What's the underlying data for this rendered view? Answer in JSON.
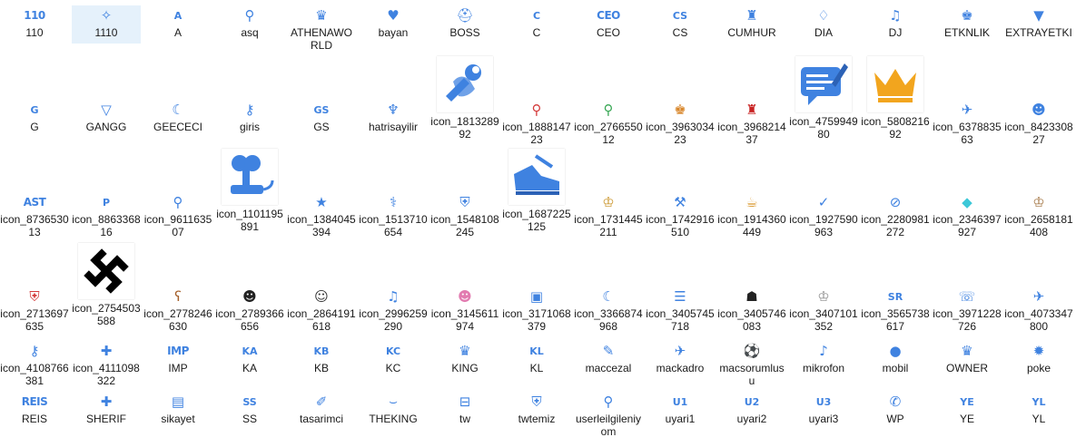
{
  "items": [
    {
      "label": "110",
      "icon": "110-text-icon",
      "text": "110"
    },
    {
      "label": "1110",
      "icon": "wings-icon",
      "glyph": "✧"
    },
    {
      "label": "A",
      "icon": "a-letter-icon",
      "text": "A"
    },
    {
      "label": "asq",
      "icon": "user-search-icon",
      "glyph": "⚲"
    },
    {
      "label": "ATHENAWORLD",
      "icon": "crown-icon",
      "glyph": "♛"
    },
    {
      "label": "bayan",
      "icon": "heart-icon",
      "glyph": "♥"
    },
    {
      "label": "BOSS",
      "icon": "helmet-icon",
      "glyph": "⛑"
    },
    {
      "label": "C",
      "icon": "c-letter-icon",
      "text": "C"
    },
    {
      "label": "CEO",
      "icon": "ceo-text-icon",
      "text": "CEO"
    },
    {
      "label": "CS",
      "icon": "cs-text-icon",
      "text": "CS"
    },
    {
      "label": "CUMHUR",
      "icon": "statue-icon",
      "glyph": "♜"
    },
    {
      "label": "DIA",
      "icon": "diamond-icon",
      "glyph": "♢"
    },
    {
      "label": "DJ",
      "icon": "music-note-icon",
      "glyph": "♫"
    },
    {
      "label": "ETKNLIK",
      "icon": "staff-user-icon",
      "glyph": "♚"
    },
    {
      "label": "EXTRAYETKI",
      "icon": "triangle-badge-icon",
      "glyph": "▼"
    },
    {
      "label": "G",
      "icon": "g-letter-icon",
      "text": "G"
    },
    {
      "label": "GANGG",
      "icon": "v-shield-icon",
      "glyph": "▽"
    },
    {
      "label": "GEECECI",
      "icon": "moon-icon",
      "glyph": "☾"
    },
    {
      "label": "giris",
      "icon": "key-icon",
      "glyph": "⚷"
    },
    {
      "label": "GS",
      "icon": "gs-text-icon",
      "text": "GS"
    },
    {
      "label": "hatrisayilir",
      "icon": "wings-emblem-icon",
      "glyph": "♆"
    },
    {
      "label": "icon_181328992",
      "icon": "wrench-hand-icon",
      "big": "wrench"
    },
    {
      "label": "icon_188814723",
      "icon": "user-red-badge-icon",
      "glyph": "⚲",
      "color": "#d43b3b"
    },
    {
      "label": "icon_276655012",
      "icon": "user-green-badge-icon",
      "glyph": "⚲",
      "color": "#3aa856"
    },
    {
      "label": "icon_396303423",
      "icon": "king-avatar-icon",
      "glyph": "♚",
      "color": "#d8862a"
    },
    {
      "label": "icon_396821437",
      "icon": "red-top-hat-icon",
      "glyph": "♜",
      "color": "#c82121"
    },
    {
      "label": "icon_475994980",
      "icon": "chat-edit-icon",
      "big": "chat"
    },
    {
      "label": "icon_580821692",
      "icon": "gold-crown-icon",
      "big": "crown"
    },
    {
      "label": "icon_637883563",
      "icon": "running-soldier-icon",
      "glyph": "✈"
    },
    {
      "label": "icon_842330827",
      "icon": "user-icon",
      "glyph": "☻"
    },
    {
      "label": "icon_873653013",
      "icon": "ast-text-icon",
      "text": "AST"
    },
    {
      "label": "icon_886336816",
      "icon": "p-badge-icon",
      "text": "P"
    },
    {
      "label": "icon_961163507",
      "icon": "user-search-icon",
      "glyph": "⚲"
    },
    {
      "label": "icon_1101195891",
      "icon": "joystick-icon",
      "big": "joystick"
    },
    {
      "label": "icon_1384045394",
      "icon": "star-icon",
      "glyph": "★"
    },
    {
      "label": "icon_1513710654",
      "icon": "syringe-icon",
      "glyph": "⚕"
    },
    {
      "label": "icon_1548108245",
      "icon": "shield-icon",
      "glyph": "⛨"
    },
    {
      "label": "icon_1687225125",
      "icon": "sneaker-icon",
      "big": "shoe"
    },
    {
      "label": "icon_1731445211",
      "icon": "trophy-icon",
      "glyph": "♔",
      "color": "#c89020"
    },
    {
      "label": "icon_1742916510",
      "icon": "gavel-icon",
      "glyph": "⚒"
    },
    {
      "label": "icon_1914360449",
      "icon": "beer-mug-icon",
      "glyph": "☕",
      "color": "#d8962a"
    },
    {
      "label": "icon_1927590963",
      "icon": "checkmark-icon",
      "glyph": "✓"
    },
    {
      "label": "icon_2280981272",
      "icon": "bandage-icon",
      "glyph": "⊘"
    },
    {
      "label": "icon_2346397927",
      "icon": "gem-icon",
      "glyph": "◆",
      "color": "#3dc8d8"
    },
    {
      "label": "icon_2658181408",
      "icon": "bronze-trophy-icon",
      "glyph": "♔",
      "color": "#a0703c"
    },
    {
      "label": "icon_2713697635",
      "icon": "red-shield-icon",
      "glyph": "⛨",
      "color": "#d43b3b"
    },
    {
      "label": "icon_2754503588",
      "icon": "swastika-icon",
      "big": "swastika"
    },
    {
      "label": "icon_2778246630",
      "icon": "teddy-bear-icon",
      "glyph": "ʕ",
      "color": "#a5602a"
    },
    {
      "label": "icon_2789366656",
      "icon": "cat-face-icon",
      "glyph": "☻",
      "color": "#222222"
    },
    {
      "label": "icon_2864191618",
      "icon": "face-icon",
      "glyph": "☺",
      "color": "#333333"
    },
    {
      "label": "icon_2996259290",
      "icon": "bell-icon",
      "glyph": "♫"
    },
    {
      "label": "icon_3145611974",
      "icon": "pink-cat-icon",
      "glyph": "☻",
      "color": "#e27bb0"
    },
    {
      "label": "icon_3171068379",
      "icon": "clipboard-icon",
      "glyph": "▣"
    },
    {
      "label": "icon_3366874968",
      "icon": "moon-badge-icon",
      "glyph": "☾"
    },
    {
      "label": "icon_3405745718",
      "icon": "checklist-icon",
      "glyph": "☰"
    },
    {
      "label": "icon_3405746083",
      "icon": "space-invader-icon",
      "glyph": "☗",
      "color": "#222222"
    },
    {
      "label": "icon_3407101352",
      "icon": "silver-trophy-icon",
      "glyph": "♔",
      "color": "#8a8a8a"
    },
    {
      "label": "icon_3565738617",
      "icon": "sr-text-icon",
      "text": "SR"
    },
    {
      "label": "icon_3971228726",
      "icon": "phone-ring-icon",
      "glyph": "☏"
    },
    {
      "label": "icon_4073347800",
      "icon": "airplane-icon",
      "glyph": "✈"
    },
    {
      "label": "icon_4108766381",
      "icon": "key-icon",
      "glyph": "⚷"
    },
    {
      "label": "icon_4111098322",
      "icon": "user-plus-icon",
      "glyph": "✚"
    },
    {
      "label": "IMP",
      "icon": "imp-text-icon",
      "text": "IMP"
    },
    {
      "label": "KA",
      "icon": "ka-text-icon",
      "text": "KA"
    },
    {
      "label": "KB",
      "icon": "kb-text-icon",
      "text": "KB"
    },
    {
      "label": "KC",
      "icon": "kc-text-icon",
      "text": "KC"
    },
    {
      "label": "KING",
      "icon": "crown-icon",
      "glyph": "♛"
    },
    {
      "label": "KL",
      "icon": "kl-text-icon",
      "text": "KL"
    },
    {
      "label": "maccezal",
      "icon": "whistle-icon",
      "glyph": "✎"
    },
    {
      "label": "mackadro",
      "icon": "kick-icon",
      "glyph": "✈"
    },
    {
      "label": "macsorumlusu",
      "icon": "soccer-ball-icon",
      "glyph": "⚽"
    },
    {
      "label": "mikrofon",
      "icon": "microphone-icon",
      "glyph": "♪"
    },
    {
      "label": "mobil",
      "icon": "apple-icon",
      "glyph": "●"
    },
    {
      "label": "OWNER",
      "icon": "owner-badge-icon",
      "glyph": "♛"
    },
    {
      "label": "poke",
      "icon": "burst-icon",
      "glyph": "✹"
    },
    {
      "label": "REIS",
      "icon": "reis-text-icon",
      "text": "REIS"
    },
    {
      "label": "SHERIF",
      "icon": "user-plus-icon",
      "glyph": "✚"
    },
    {
      "label": "sikayet",
      "icon": "contact-book-icon",
      "glyph": "▤"
    },
    {
      "label": "SS",
      "icon": "ss-text-icon",
      "text": "SS"
    },
    {
      "label": "tasarimci",
      "icon": "paintbrush-icon",
      "glyph": "✐"
    },
    {
      "label": "THEKING",
      "icon": "mustache-icon",
      "glyph": "⌣"
    },
    {
      "label": "tw",
      "icon": "tw-badge-icon",
      "glyph": "⊟"
    },
    {
      "label": "twtemiz",
      "icon": "shield-icon",
      "glyph": "⛨"
    },
    {
      "label": "userleilgileniyom",
      "icon": "user-magnify-icon",
      "glyph": "⚲"
    },
    {
      "label": "uyari1",
      "icon": "u1-text-icon",
      "text": "U1"
    },
    {
      "label": "uyari2",
      "icon": "u2-text-icon",
      "text": "U2"
    },
    {
      "label": "uyari3",
      "icon": "u3-text-icon",
      "text": "U3"
    },
    {
      "label": "WP",
      "icon": "whatsapp-icon",
      "glyph": "✆"
    },
    {
      "label": "YE",
      "icon": "ye-text-icon",
      "text": "YE"
    },
    {
      "label": "YL",
      "icon": "yl-text-icon",
      "text": "YL"
    }
  ],
  "selected_label": "1110",
  "colors": {
    "icon_blue": "#3f82e0",
    "selection": "#e5f1fb"
  }
}
